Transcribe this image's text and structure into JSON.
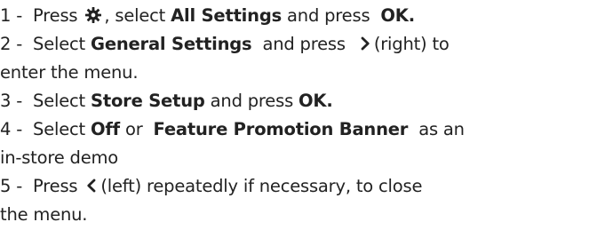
{
  "instructions": {
    "steps": [
      {
        "num": "1 -",
        "t1": "Press",
        "icon": "gear-icon",
        "t2": ", select",
        "b1": "All Settings",
        "t3": "and press",
        "b2": "OK."
      },
      {
        "num": "2 -",
        "t1": "Select",
        "b1": "General Settings",
        "t2": "and press",
        "icon": "chevron-right-icon",
        "t3": "(right) to",
        "t4": "enter the menu."
      },
      {
        "num": "3 -",
        "t1": "Select",
        "b1": "Store Setup",
        "t2": "and press",
        "b2": "OK."
      },
      {
        "num": "4 -",
        "t1": "Select",
        "b1": "Off",
        "t2": "or",
        "b2": "Feature Promotion Banner",
        "t3": "as an",
        "t4": "in-store demo"
      },
      {
        "num": "5 -",
        "t1": "Press",
        "icon": "chevron-left-icon",
        "t2": "(left) repeatedly if necessary, to close",
        "t3": "the menu."
      }
    ]
  }
}
